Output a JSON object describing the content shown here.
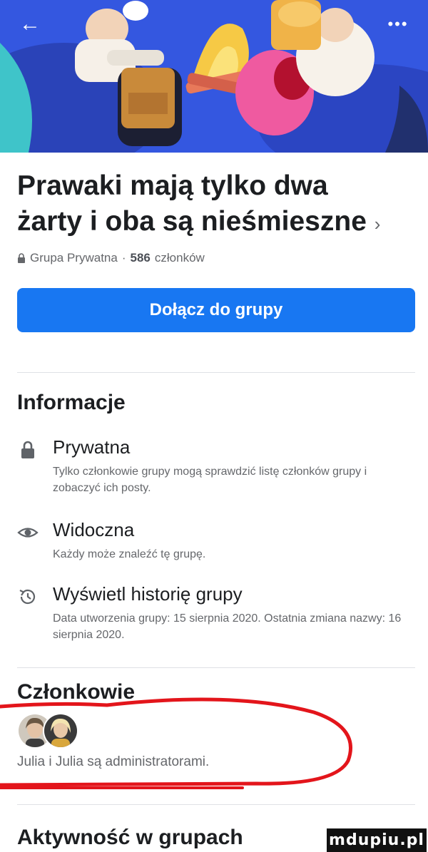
{
  "group": {
    "title": "Prawaki mają tylko dwa żarty i oba są nieśmieszne",
    "chevron": "›",
    "privacy_label": "Grupa Prywatna",
    "separator": "·",
    "member_count": "586",
    "member_word": "członków"
  },
  "top_bar": {
    "back_icon": "back-arrow-icon",
    "more_label": "•••"
  },
  "join_button": {
    "label": "Dołącz do grupy"
  },
  "info": {
    "heading": "Informacje",
    "items": [
      {
        "icon": "lock-icon",
        "title": "Prywatna",
        "desc": "Tylko członkowie grupy mogą sprawdzić listę członków grupy i zobaczyć ich posty."
      },
      {
        "icon": "eye-icon",
        "title": "Widoczna",
        "desc": "Każdy może znaleźć tę grupę."
      },
      {
        "icon": "history-icon",
        "title": "Wyświetl historię grupy",
        "desc": "Data utworzenia grupy: 15 sierpnia 2020. Ostatnia zmiana nazwy: 16 sierpnia 2020."
      }
    ]
  },
  "members": {
    "heading": "Członkowie",
    "admins_text": "Julia i Julia są administratorami."
  },
  "activity": {
    "heading": "Aktywność w grupach"
  },
  "watermark": {
    "text": "mdupiu.pl"
  },
  "colors": {
    "accent": "#1877f2",
    "annotation_red": "#e3151b"
  }
}
